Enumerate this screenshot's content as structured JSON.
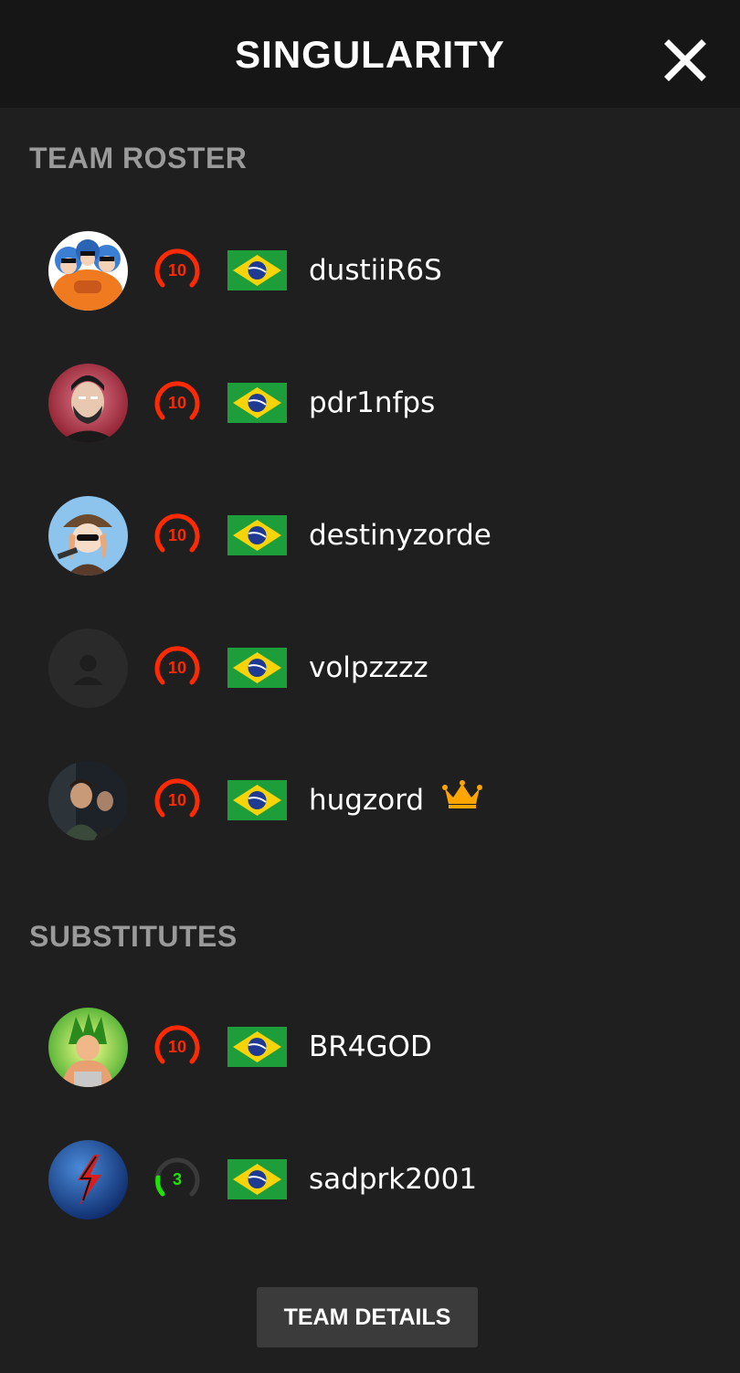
{
  "header": {
    "title": "SINGULARITY",
    "close_icon": "close-icon"
  },
  "roster": {
    "title": "TEAM ROSTER",
    "players": [
      {
        "nickname": "dustiiR6S",
        "level": "10",
        "country": "Brazil",
        "flag_icon": "brazil-flag-icon",
        "captain": false
      },
      {
        "nickname": "pdr1nfps",
        "level": "10",
        "country": "Brazil",
        "flag_icon": "brazil-flag-icon",
        "captain": false
      },
      {
        "nickname": "destinyzorde",
        "level": "10",
        "country": "Brazil",
        "flag_icon": "brazil-flag-icon",
        "captain": false
      },
      {
        "nickname": "volpzzzz",
        "level": "10",
        "country": "Brazil",
        "flag_icon": "brazil-flag-icon",
        "captain": false
      },
      {
        "nickname": "hugzord",
        "level": "10",
        "country": "Brazil",
        "flag_icon": "brazil-flag-icon",
        "captain": true
      }
    ]
  },
  "substitutes": {
    "title": "SUBSTITUTES",
    "players": [
      {
        "nickname": "BR4GOD",
        "level": "10",
        "country": "Brazil",
        "flag_icon": "brazil-flag-icon",
        "captain": false
      },
      {
        "nickname": "sadprk2001",
        "level": "3",
        "country": "Brazil",
        "flag_icon": "brazil-flag-icon",
        "captain": false
      }
    ]
  },
  "footer": {
    "button_label": "TEAM DETAILS"
  },
  "colors": {
    "background": "#1f1f1f",
    "header_bg": "#161616",
    "section_title": "#9a9a9a",
    "level_10": "#ff2a00",
    "level_3": "#1ce400",
    "crown": "#ffa500",
    "button_bg": "#3b3b3b"
  }
}
